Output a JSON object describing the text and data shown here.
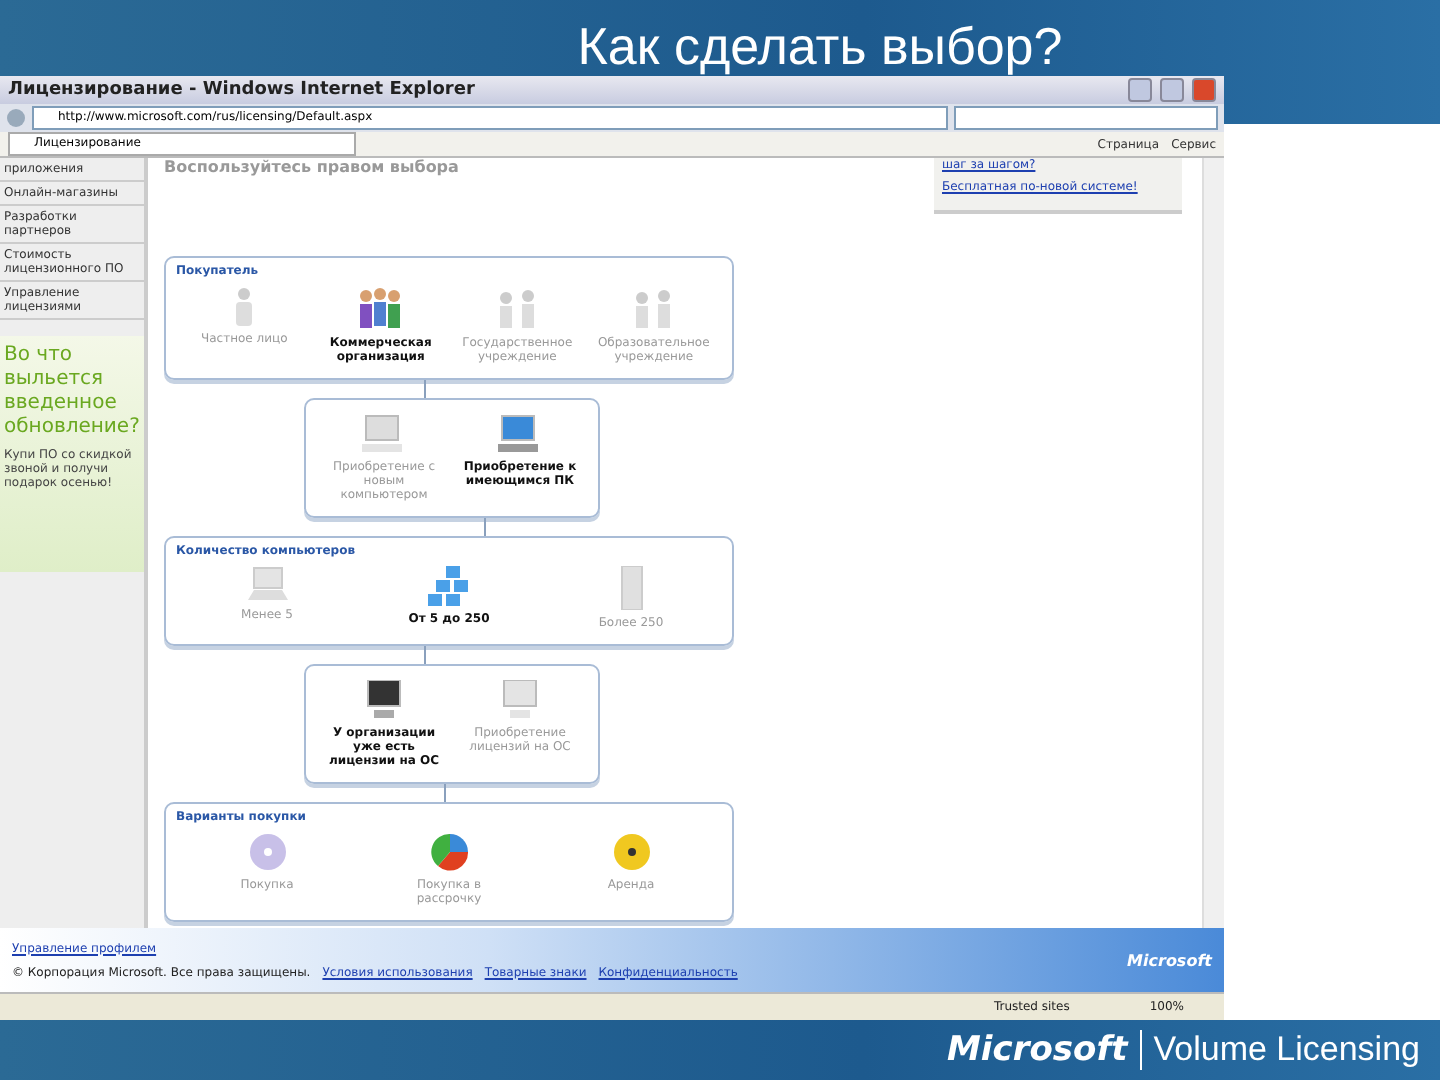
{
  "slide_title": "Как сделать выбор?",
  "browser": {
    "title": "Лицензирование - Windows Internet Explorer",
    "address": "http://www.microsoft.com/rus/licensing/Default.aspx",
    "tab": "Лицензирование",
    "commands": [
      "Страница",
      "Сервис"
    ],
    "status_zone": "Trusted sites",
    "zoom": "100%"
  },
  "sidebar": {
    "items": [
      "приложения",
      "Онлайн-магазины",
      "Разработки партнеров",
      "Стоимость лицензионного ПО",
      "Управление лицензиями"
    ],
    "ad_headline": "Во что выльется введенное обновление?",
    "ad_text": "Купи ПО со скидкой звоной и получи подарок осенью!"
  },
  "page_heading": "Воспользуйтесь правом выбора",
  "side_links": [
    "шаг за шагом?",
    "Бесплатная по-новой системе!"
  ],
  "sections": [
    {
      "title": "Покупатель",
      "wide": true,
      "options": [
        {
          "label": "Частное лицо",
          "kind": "person",
          "selected": false
        },
        {
          "label": "Коммерческая организация",
          "kind": "people",
          "selected": true
        },
        {
          "label": "Государственное учреждение",
          "kind": "group",
          "selected": false
        },
        {
          "label": "Образовательное учреждение",
          "kind": "group",
          "selected": false
        }
      ]
    },
    {
      "wide": false,
      "options": [
        {
          "label": "Приобретение с новым компьютером",
          "kind": "computer",
          "selected": false
        },
        {
          "label": "Приобретение к имеющимся ПК",
          "kind": "computer",
          "selected": true
        }
      ]
    },
    {
      "title": "Количество компьютеров",
      "wide": true,
      "options": [
        {
          "label": "Менее 5",
          "kind": "laptop",
          "selected": false
        },
        {
          "label": "От 5 до 250",
          "kind": "cluster",
          "selected": true
        },
        {
          "label": "Более 250",
          "kind": "server",
          "selected": false
        }
      ]
    },
    {
      "wide": false,
      "options": [
        {
          "label": "У организации уже есть лицензии на ОС",
          "kind": "monitor",
          "selected": true
        },
        {
          "label": "Приобретение лицензий на ОС",
          "kind": "monitor",
          "selected": false
        }
      ]
    },
    {
      "title": "Варианты покупки",
      "wide": true,
      "options": [
        {
          "label": "Покупка",
          "kind": "disc",
          "selected": false
        },
        {
          "label": "Покупка в рассрочку",
          "kind": "pie",
          "selected": false
        },
        {
          "label": "Аренда",
          "kind": "yellowdisc",
          "selected": false
        }
      ]
    }
  ],
  "footer": {
    "profile_link": "Управление профилем",
    "copyright": "© Корпорация Microsoft. Все права защищены.",
    "links": [
      "Условия использования",
      "Товарные знаки",
      "Конфиденциальность"
    ],
    "logo": "Microsoft"
  },
  "slide_footer": {
    "brand": "Microsoft",
    "product": "Volume Licensing"
  }
}
